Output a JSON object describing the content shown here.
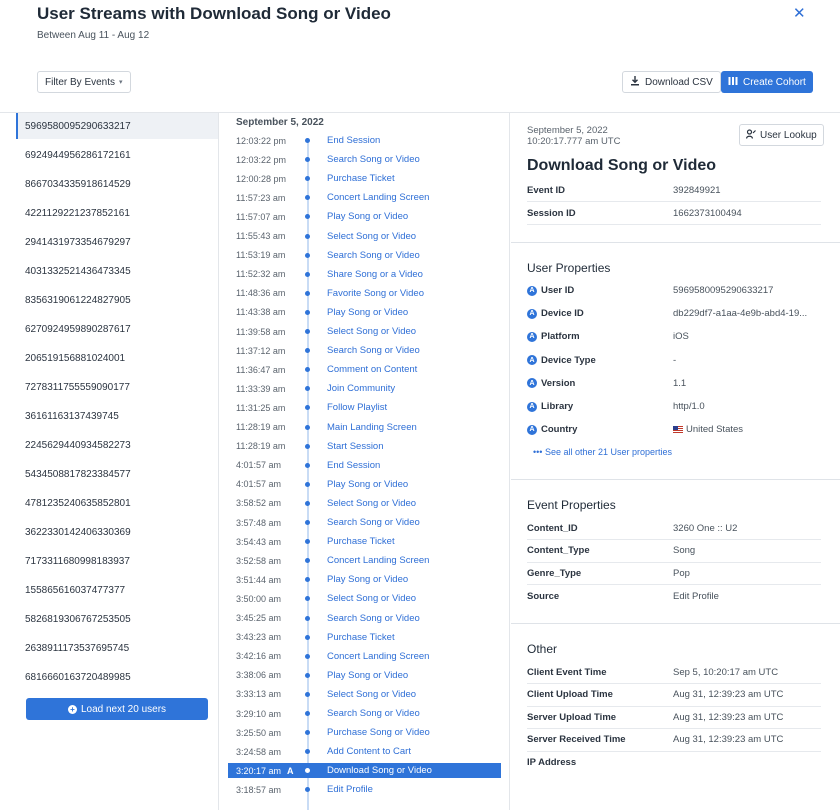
{
  "header": {
    "title": "User Streams with Download Song or Video",
    "subtitle": "Between Aug 11 - Aug 12",
    "close_symbol": "✕"
  },
  "toolbar": {
    "filter_label": "Filter By Events",
    "download_csv_label": "Download CSV",
    "create_cohort_label": "Create Cohort"
  },
  "users": {
    "items": [
      "5969580095290633217",
      "6924944956286172161",
      "8667034335918614529",
      "4221129221237852161",
      "2941431973354679297",
      "4031332521436473345",
      "8356319061224827905",
      "6270924959890287617",
      "206519156881024001",
      "7278311755559090177",
      "36161163137439745",
      "2245629440934582273",
      "5434508817823384577",
      "4781235240635852801",
      "3622330142406330369",
      "7173311680998183937",
      "155865616037477377",
      "5826819306767253505",
      "2638911173537695745",
      "6816660163720489985"
    ],
    "load_next_label": "Load next 20 users"
  },
  "timeline": {
    "date": "September 5, 2022",
    "selected_badge": "A",
    "events": [
      {
        "time": "12:03:22 pm",
        "name": "End Session"
      },
      {
        "time": "12:03:22 pm",
        "name": "Search Song or Video"
      },
      {
        "time": "12:00:28 pm",
        "name": "Purchase Ticket"
      },
      {
        "time": "11:57:23 am",
        "name": "Concert Landing Screen"
      },
      {
        "time": "11:57:07 am",
        "name": "Play Song or Video"
      },
      {
        "time": "11:55:43 am",
        "name": "Select Song or Video"
      },
      {
        "time": "11:53:19 am",
        "name": "Search Song or Video"
      },
      {
        "time": "11:52:32 am",
        "name": "Share Song or a Video"
      },
      {
        "time": "11:48:36 am",
        "name": "Favorite Song or Video"
      },
      {
        "time": "11:43:38 am",
        "name": "Play Song or Video"
      },
      {
        "time": "11:39:58 am",
        "name": "Select Song or Video"
      },
      {
        "time": "11:37:12 am",
        "name": "Search Song or Video"
      },
      {
        "time": "11:36:47 am",
        "name": "Comment on Content"
      },
      {
        "time": "11:33:39 am",
        "name": "Join Community"
      },
      {
        "time": "11:31:25 am",
        "name": "Follow Playlist"
      },
      {
        "time": "11:28:19 am",
        "name": "Main Landing Screen"
      },
      {
        "time": "11:28:19 am",
        "name": "Start Session"
      },
      {
        "time": "4:01:57 am",
        "name": "End Session"
      },
      {
        "time": "4:01:57 am",
        "name": "Play Song or Video"
      },
      {
        "time": "3:58:52 am",
        "name": "Select Song or Video"
      },
      {
        "time": "3:57:48 am",
        "name": "Search Song or Video"
      },
      {
        "time": "3:54:43 am",
        "name": "Purchase Ticket"
      },
      {
        "time": "3:52:58 am",
        "name": "Concert Landing Screen"
      },
      {
        "time": "3:51:44 am",
        "name": "Play Song or Video"
      },
      {
        "time": "3:50:00 am",
        "name": "Select Song or Video"
      },
      {
        "time": "3:45:25 am",
        "name": "Search Song or Video"
      },
      {
        "time": "3:43:23 am",
        "name": "Purchase Ticket"
      },
      {
        "time": "3:42:16 am",
        "name": "Concert Landing Screen"
      },
      {
        "time": "3:38:06 am",
        "name": "Play Song or Video"
      },
      {
        "time": "3:33:13 am",
        "name": "Select Song or Video"
      },
      {
        "time": "3:29:10 am",
        "name": "Search Song or Video"
      },
      {
        "time": "3:25:50 am",
        "name": "Purchase Song or Video"
      },
      {
        "time": "3:24:58 am",
        "name": "Add Content to Cart"
      },
      {
        "time": "3:20:17 am",
        "name": "Download Song or Video"
      },
      {
        "time": "3:18:57 am",
        "name": "Edit Profile"
      }
    ]
  },
  "details": {
    "date_line1": "September 5, 2022",
    "date_line2": "10:20:17.777 am UTC",
    "user_lookup_label": "User Lookup",
    "event_title": "Download Song or Video",
    "event_rows": [
      {
        "key": "Event ID",
        "value": "392849921"
      },
      {
        "key": "Session ID",
        "value": "1662373100494"
      }
    ],
    "user_properties_title": "User Properties",
    "user_properties": [
      {
        "key": "User ID",
        "value": "5969580095290633217"
      },
      {
        "key": "Device ID",
        "value": "db229df7-a1aa-4e9b-abd4-19..."
      },
      {
        "key": "Platform",
        "value": "iOS"
      },
      {
        "key": "Device Type",
        "value": "-"
      },
      {
        "key": "Version",
        "value": "1.1"
      },
      {
        "key": "Library",
        "value": "http/1.0"
      },
      {
        "key": "Country",
        "value": "United States"
      }
    ],
    "see_all_label": "••• See all other 21 User properties",
    "event_properties_title": "Event Properties",
    "event_properties": [
      {
        "key": "Content_ID",
        "value": "3260 One :: U2"
      },
      {
        "key": "Content_Type",
        "value": "Song"
      },
      {
        "key": "Genre_Type",
        "value": "Pop"
      },
      {
        "key": "Source",
        "value": "Edit Profile"
      }
    ],
    "other_title": "Other",
    "other_rows": [
      {
        "key": "Client Event Time",
        "value": "Sep 5, 10:20:17 am UTC"
      },
      {
        "key": "Client Upload Time",
        "value": "Aug 31, 12:39:23 am UTC"
      },
      {
        "key": "Server Upload Time",
        "value": "Aug 31, 12:39:23 am UTC"
      },
      {
        "key": "Server Received Time",
        "value": "Aug 31, 12:39:23 am UTC"
      },
      {
        "key": "IP Address",
        "value": ""
      }
    ]
  }
}
